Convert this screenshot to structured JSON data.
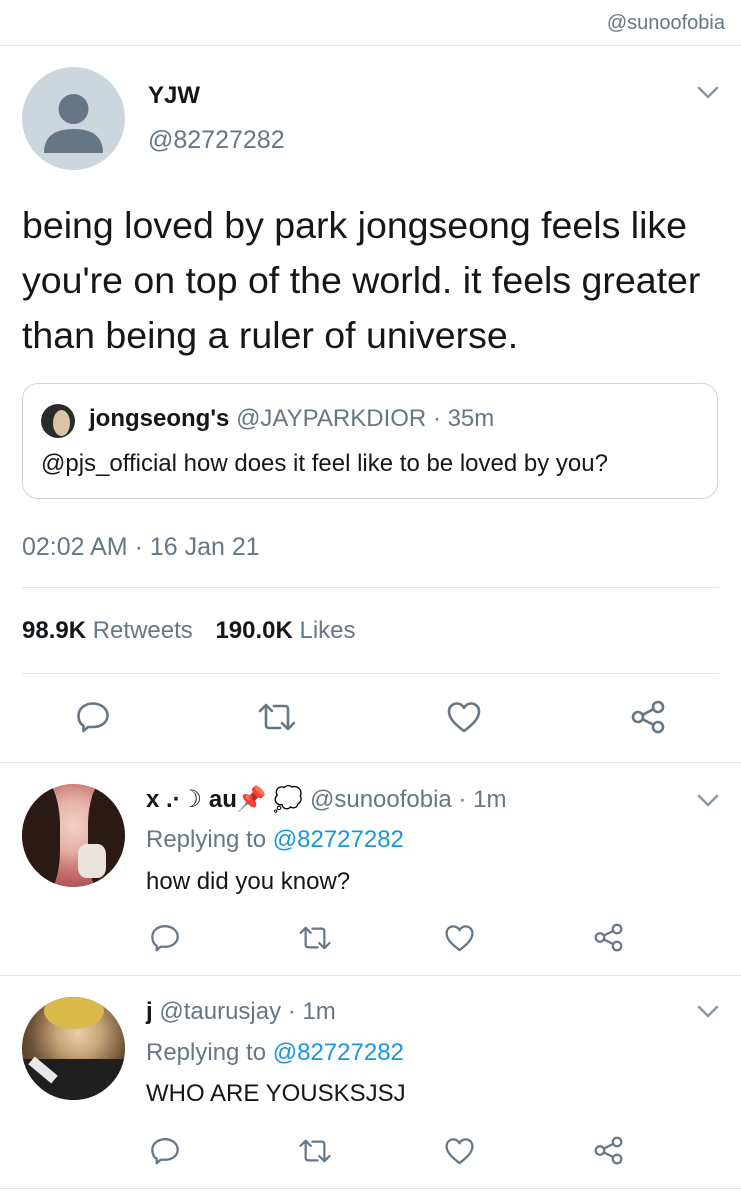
{
  "watermark": "@sunoofobia",
  "main_tweet": {
    "display_name": "YJW",
    "handle": "@82727282",
    "text": "being loved by park jongseong feels like you're on top of the world. it feels greater than being a ruler of universe.",
    "quoted": {
      "display_name": "jongseong's",
      "handle": "@JAYPARKDIOR",
      "time": "· 35m",
      "text": "@pjs_official how does it feel like to be loved by you?"
    },
    "timestamp": "02:02 AM · 16 Jan 21",
    "retweets_count": "98.9K",
    "retweets_label": "Retweets",
    "likes_count": "190.0K",
    "likes_label": "Likes"
  },
  "replies": [
    {
      "display_name": "x .·☽ au📌",
      "emoji": "💭",
      "handle": "@sunoofobia",
      "time": "· 1m",
      "replying_label": "Replying to",
      "replying_to": "@82727282",
      "text": "how did you know?"
    },
    {
      "display_name": "j",
      "handle": "@taurusjay",
      "time": "· 1m",
      "replying_label": "Replying to",
      "replying_to": "@82727282",
      "text": "WHO ARE YOUSKSJSJ"
    }
  ],
  "colors": {
    "link": "#1b95e0",
    "secondary_text": "#657786",
    "divider": "#e1e8ed"
  },
  "icons": [
    "chevron-down-icon",
    "reply-icon",
    "retweet-icon",
    "like-icon",
    "share-icon"
  ]
}
